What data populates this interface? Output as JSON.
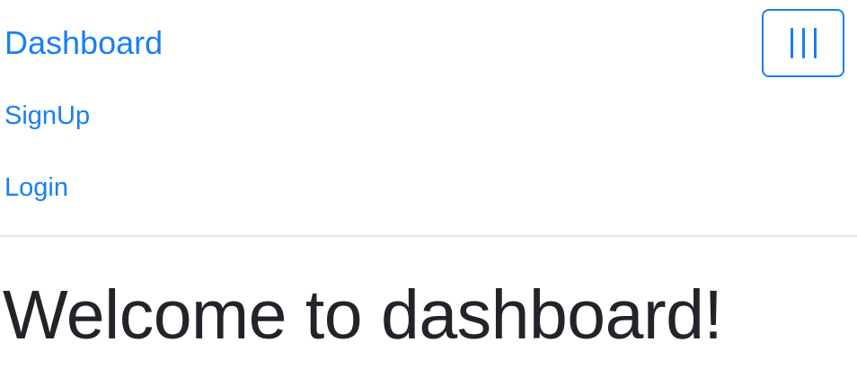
{
  "navbar": {
    "brand": "Dashboard",
    "toggler_icon": "hamburger-menu-icon",
    "links": [
      {
        "label": "SignUp"
      },
      {
        "label": "Login"
      }
    ]
  },
  "main": {
    "title": "Welcome to dashboard!"
  },
  "colors": {
    "link": "#1a7ff0",
    "text": "#212529",
    "divider": "#e5e5e5"
  }
}
